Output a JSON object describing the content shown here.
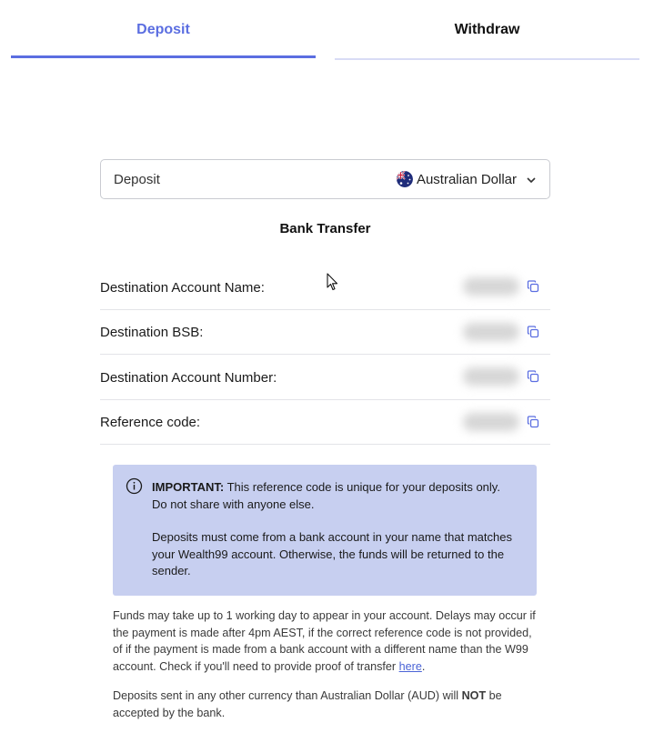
{
  "tabs": [
    {
      "label": "Deposit",
      "active": true
    },
    {
      "label": "Withdraw",
      "active": false
    }
  ],
  "currency_select": {
    "label": "Deposit",
    "selected": "Australian Dollar",
    "flag_icon": "australia-flag-icon"
  },
  "method_title": "Bank Transfer",
  "details": [
    {
      "label": "Destination Account Name:"
    },
    {
      "label": "Destination BSB:"
    },
    {
      "label": "Destination Account Number:"
    },
    {
      "label": "Reference code:"
    }
  ],
  "important": {
    "heading": "IMPORTANT:",
    "line1": " This reference code is unique for your deposits only. Do not share with anyone else.",
    "line2": "Deposits must come from a bank account in your name that matches your Wealth99 account. Otherwise, the funds will be returned to the sender."
  },
  "notes": {
    "para1": "Funds may take up to 1 working day to appear in your account. Delays may occur if the payment is made after 4pm AEST, if the correct reference code is not provided, of if the payment is made from a bank account with a different name than the W99 account. Check if you'll need to provide proof of transfer ",
    "link": "here",
    "para1_end": ".",
    "para2_start": "Deposits sent in any other currency than Australian Dollar (AUD) will ",
    "para2_bold": "NOT",
    "para2_end": " be accepted by the bank."
  },
  "colors": {
    "accent": "#5b6ee1",
    "info_bg": "#c7cff0"
  }
}
